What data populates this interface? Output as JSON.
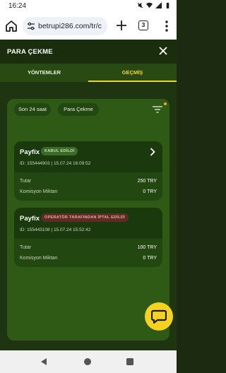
{
  "status": {
    "time": "16:24"
  },
  "browser": {
    "url": "betrupi286.com/tr/c",
    "tab_count": "3"
  },
  "modal": {
    "title": "PARA ÇEKME",
    "tabs": [
      {
        "label": "YÖNTEMLER",
        "active": false
      },
      {
        "label": "GEÇMİŞ",
        "active": true
      }
    ],
    "filters": [
      "Son 24 saat",
      "Para Çekme"
    ],
    "transactions": [
      {
        "method": "Payfix",
        "status": "KABUL EDİLDİ",
        "meta": "ID: 155444903   |   15.07.24 16:09:52",
        "amount_label": "Tutar",
        "amount": "250 TRY",
        "fee_label": "Komisyon Miktarı",
        "fee": "0 TRY"
      },
      {
        "method": "Payfix",
        "status": "OPERATÖR TARAFINDAN İPTAL EDİLDİ",
        "meta": "ID: 155443108   |   15.07.24 15:52:42",
        "amount_label": "Tutar",
        "amount": "100 TRY",
        "fee_label": "Komisyon Miktarı",
        "fee": "0 TRY"
      }
    ]
  },
  "colors": {
    "accent": "#f5d21f",
    "panel": "#2f5a16",
    "header": "#1a2e0e",
    "status_ok": "#3c6a2a",
    "status_cancel": "#5a2d26"
  },
  "icons": [
    "home-icon",
    "site-settings-icon",
    "new-tab-icon",
    "more-vert-icon",
    "close-icon",
    "filter-icon",
    "chevron-right-icon",
    "chat-icon",
    "nav-back-icon",
    "nav-home-icon",
    "nav-recent-icon"
  ]
}
